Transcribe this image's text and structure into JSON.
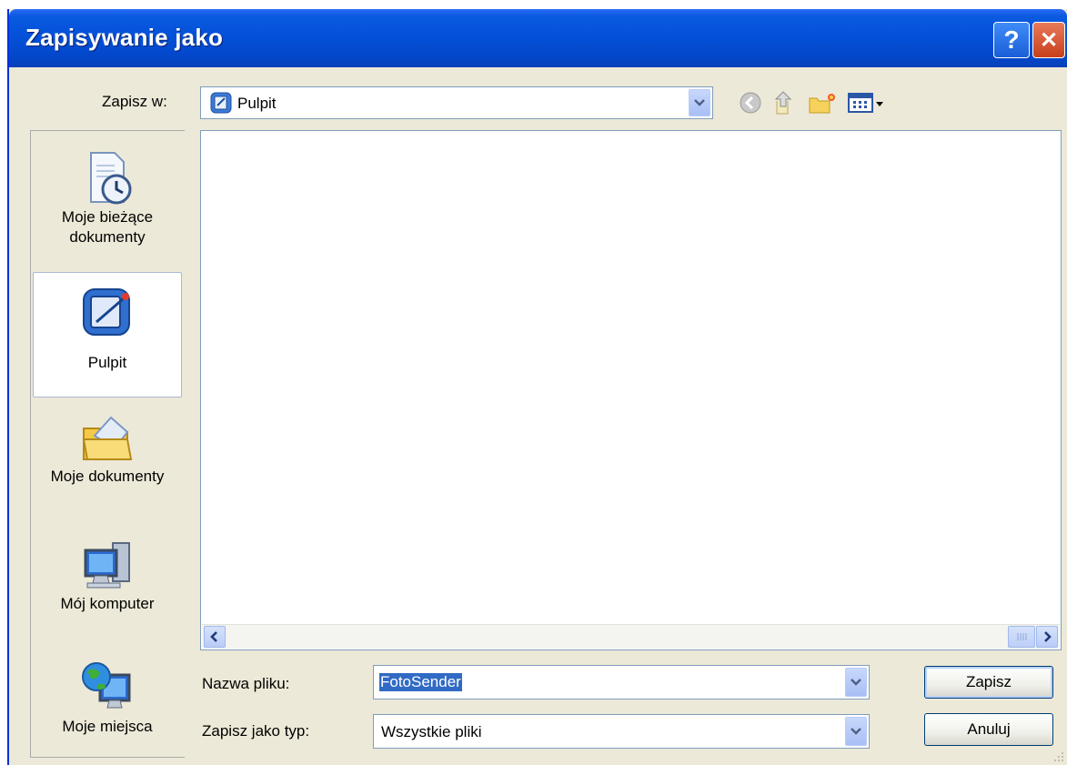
{
  "window": {
    "title": "Zapisywanie jako"
  },
  "titlebar": {
    "help_glyph": "?",
    "close_glyph": "✕"
  },
  "toolbar": {
    "save_in_label": "Zapisz w:",
    "location_value": "Pulpit",
    "icons": [
      "back-icon",
      "up-folder-icon",
      "new-folder-icon",
      "view-menu-icon"
    ]
  },
  "places": [
    {
      "label_line1": "Moje bieżące",
      "label_line2": "dokumenty",
      "icon": "recent-documents-icon"
    },
    {
      "label_line1": "Pulpit",
      "label_line2": "",
      "icon": "desktop-icon",
      "selected": true
    },
    {
      "label_line1": "Moje dokumenty",
      "label_line2": "",
      "icon": "my-documents-icon"
    },
    {
      "label_line1": "Mój komputer",
      "label_line2": "",
      "icon": "my-computer-icon"
    },
    {
      "label_line1": "Moje miejsca",
      "label_line2": "",
      "icon": "network-places-icon"
    }
  ],
  "form": {
    "filename_label": "Nazwa pliku:",
    "filename_value": "FotoSender",
    "filetype_label": "Zapisz jako typ:",
    "filetype_value": "Wszystkie pliki"
  },
  "buttons": {
    "save": "Zapisz",
    "cancel": "Anuluj"
  },
  "colors": {
    "title_blue": "#0450d8",
    "face": "#ece9d8",
    "selection": "#316ac5"
  }
}
